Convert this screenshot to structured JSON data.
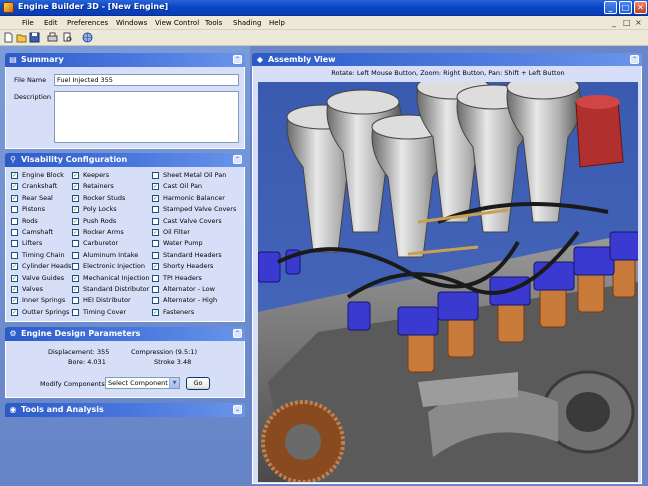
{
  "window": {
    "title": "Engine Builder 3D - [New Engine]",
    "controls": [
      "_",
      "□",
      "✕"
    ]
  },
  "menu": {
    "items": [
      "File",
      "Edit",
      "Preferences",
      "Windows",
      "View Control",
      "Tools",
      "Shading",
      "Help"
    ],
    "mdi_controls": [
      "_",
      "□",
      "×"
    ]
  },
  "toolbar": {
    "icons": [
      "new-file-icon",
      "open-folder-icon",
      "save-icon",
      "print-icon",
      "print-preview-icon",
      "web-icon"
    ]
  },
  "summary": {
    "title": "Summary",
    "file_name_label": "File Name",
    "file_name_value": "Fuel Injected 355",
    "description_label": "Description",
    "description_value": ""
  },
  "visibility": {
    "title": "Visability Configuration",
    "columns": [
      [
        {
          "label": "Engine Block",
          "checked": true
        },
        {
          "label": "Crankshaft",
          "checked": true
        },
        {
          "label": "Rear Seal",
          "checked": true
        },
        {
          "label": "Pistons",
          "checked": false
        },
        {
          "label": "Rods",
          "checked": false
        },
        {
          "label": "Camshaft",
          "checked": false
        },
        {
          "label": "Lifters",
          "checked": false
        },
        {
          "label": "Timing Chain",
          "checked": false
        },
        {
          "label": "Cylinder Heads",
          "checked": true
        },
        {
          "label": "Valve Guides",
          "checked": true
        },
        {
          "label": "Valves",
          "checked": true
        },
        {
          "label": "Inner Springs",
          "checked": true
        },
        {
          "label": "Outter Springs",
          "checked": true
        }
      ],
      [
        {
          "label": "Keepers",
          "checked": true
        },
        {
          "label": "Retainers",
          "checked": true
        },
        {
          "label": "Rocker Studs",
          "checked": true
        },
        {
          "label": "Poly Locks",
          "checked": true
        },
        {
          "label": "Push Rods",
          "checked": true
        },
        {
          "label": "Rocker Arms",
          "checked": true
        },
        {
          "label": "Carburetor",
          "checked": false
        },
        {
          "label": "Aluminum Intake",
          "checked": false
        },
        {
          "label": "Electronic Injection",
          "checked": false
        },
        {
          "label": "Mechanical Injection",
          "checked": true
        },
        {
          "label": "Standard Distributor",
          "checked": true
        },
        {
          "label": "HEI Distributor",
          "checked": false
        },
        {
          "label": "Timing Cover",
          "checked": false
        }
      ],
      [
        {
          "label": "Sheet Metal Oil Pan",
          "checked": false
        },
        {
          "label": "Cast Oil Pan",
          "checked": true
        },
        {
          "label": "Harmonic Balancer",
          "checked": true
        },
        {
          "label": "Stamped Valve Covers",
          "checked": false
        },
        {
          "label": "Cast Valve Covers",
          "checked": false
        },
        {
          "label": "Oil Filter",
          "checked": true
        },
        {
          "label": "Water Pump",
          "checked": false
        },
        {
          "label": "Standard Headers",
          "checked": false
        },
        {
          "label": "Shorty Headers",
          "checked": true
        },
        {
          "label": "TPI Headers",
          "checked": false
        },
        {
          "label": "Alternator - Low",
          "checked": false
        },
        {
          "label": "Alternator - High",
          "checked": false
        },
        {
          "label": "Fasteners",
          "checked": true
        }
      ]
    ]
  },
  "design": {
    "title": "Engine Design Parameters",
    "displacement": "Displacement: 355",
    "compression": "Compression (9.5:1)",
    "bore": "Bore: 4.031",
    "stroke": "Stroke 3.48",
    "modify_label": "Modify Components:",
    "select_value": "Select Component",
    "go_label": "Go"
  },
  "tools": {
    "title": "Tools and Analysis"
  },
  "assembly": {
    "title": "Assembly View",
    "hint": "Rotate: Left Mouse Button,  Zoom: Right Button,  Pan: Shift + Left Button"
  },
  "colors": {
    "title_bar": "#0a46c8",
    "pane_bg": "#d6dff7",
    "viewport_bg": "#3f5fb3",
    "check_mark": "#21a121"
  }
}
